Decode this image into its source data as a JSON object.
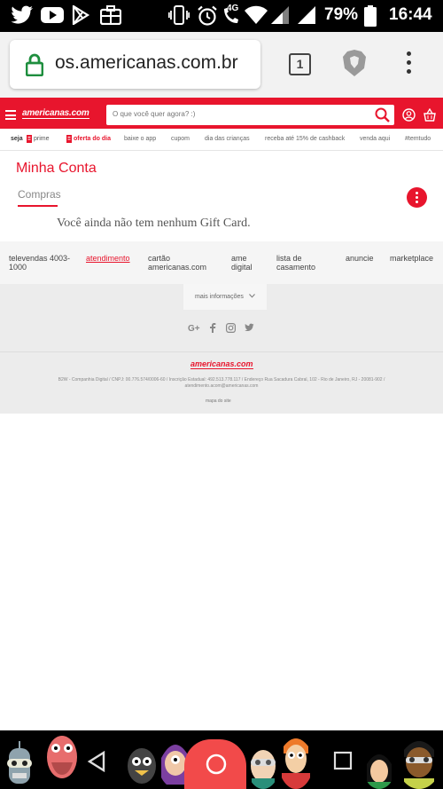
{
  "status_bar": {
    "network": "4G",
    "battery": "79%",
    "time": "16:44"
  },
  "browser": {
    "url": "os.americanas.com.br",
    "tab_count": "1"
  },
  "header": {
    "logo": "americanas.com",
    "search_placeholder": "O que você quer agora? :)"
  },
  "nav": {
    "items": [
      {
        "label": "seja"
      },
      {
        "label": "prime"
      },
      {
        "label": "oferta do dia"
      },
      {
        "label": "baixe o app"
      },
      {
        "label": "cupom"
      },
      {
        "label": "dia das crianças"
      },
      {
        "label": "receba até 15% de cashback"
      },
      {
        "label": "venda aqui"
      },
      {
        "label": "#temtudo"
      }
    ]
  },
  "main": {
    "title": "Minha Conta",
    "tab": "Compras",
    "empty_message": "Você ainda não tem nenhum Gift Card."
  },
  "footer_links": [
    {
      "line1": "televendas 4003-",
      "line2": "1000"
    },
    {
      "line1": "atendimento",
      "line2": ""
    },
    {
      "line1": "cartão",
      "line2": "americanas.com"
    },
    {
      "line1": "ame",
      "line2": "digital"
    },
    {
      "line1": "lista de",
      "line2": "casamento"
    },
    {
      "line1": "anuncie",
      "line2": ""
    },
    {
      "line1": "marketplace",
      "line2": ""
    }
  ],
  "footer": {
    "more_info": "mais informações",
    "logo": "americanas.com",
    "legal_line1": "B2W - Companhia Digital / CNPJ: 00.776.574/0006-60 / Inscrição Estadual: 492.513.778.117 / Endereço Rua Sacadura Cabral, 102 - Rio de Janeiro, RJ - 20081-902 /",
    "legal_line2": "atendimento.acom@americanas.com",
    "sitemap": "mapa do site"
  },
  "colors": {
    "brand_red": "#e8152d"
  }
}
